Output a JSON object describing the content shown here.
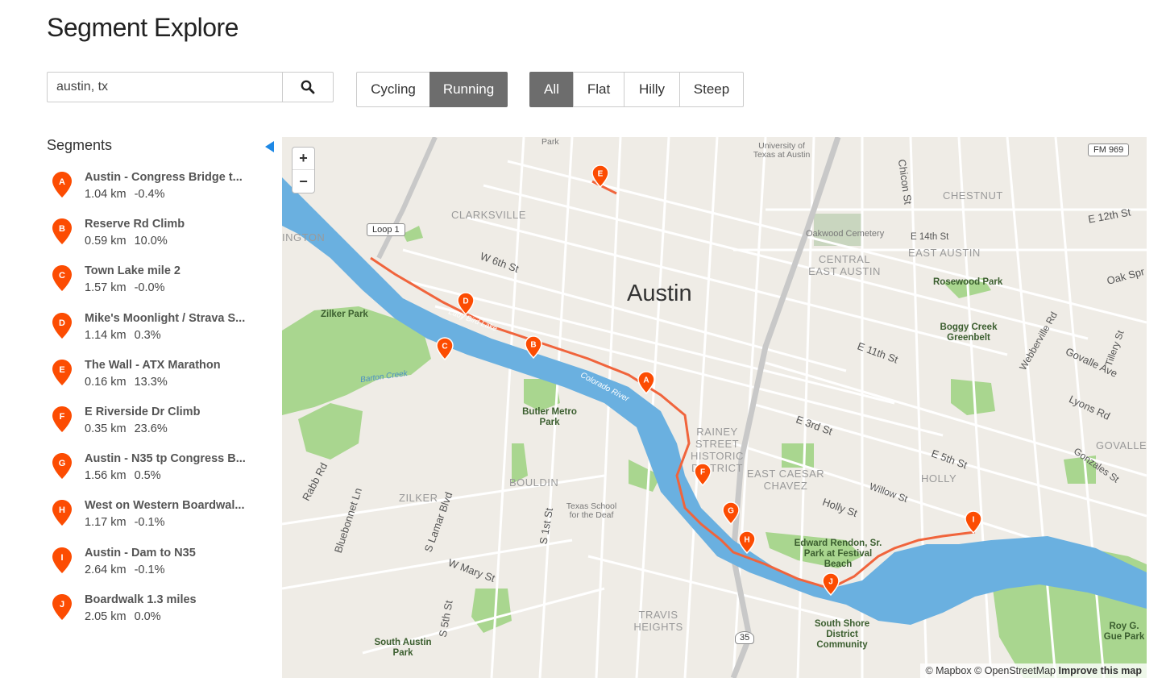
{
  "page": {
    "title": "Segment Explore"
  },
  "search": {
    "value": "austin, tx",
    "icon": "search-icon"
  },
  "sport_filter": [
    {
      "label": "Cycling",
      "active": false
    },
    {
      "label": "Running",
      "active": true
    }
  ],
  "terrain_filter": [
    {
      "label": "All",
      "active": true
    },
    {
      "label": "Flat",
      "active": false
    },
    {
      "label": "Hilly",
      "active": false
    },
    {
      "label": "Steep",
      "active": false
    }
  ],
  "sidebar": {
    "heading": "Segments",
    "segments": [
      {
        "letter": "A",
        "name": "Austin - Congress Bridge t...",
        "distance": "1.04 km",
        "grade": "-0.4%"
      },
      {
        "letter": "B",
        "name": "Reserve Rd Climb",
        "distance": "0.59 km",
        "grade": "10.0%"
      },
      {
        "letter": "C",
        "name": "Town Lake mile 2",
        "distance": "1.57 km",
        "grade": "-0.0%"
      },
      {
        "letter": "D",
        "name": "Mike's Moonlight / Strava S...",
        "distance": "1.14 km",
        "grade": "0.3%"
      },
      {
        "letter": "E",
        "name": "The Wall - ATX Marathon",
        "distance": "0.16 km",
        "grade": "13.3%"
      },
      {
        "letter": "F",
        "name": "E Riverside Dr Climb",
        "distance": "0.35 km",
        "grade": "23.6%"
      },
      {
        "letter": "G",
        "name": "Austin - N35 tp Congress B...",
        "distance": "1.56 km",
        "grade": "0.5%"
      },
      {
        "letter": "H",
        "name": "West on Western Boardwal...",
        "distance": "1.17 km",
        "grade": "-0.1%"
      },
      {
        "letter": "I",
        "name": "Austin - Dam to N35",
        "distance": "2.64 km",
        "grade": "-0.1%"
      },
      {
        "letter": "J",
        "name": "Boardwalk 1.3 miles",
        "distance": "2.05 km",
        "grade": "0.0%"
      }
    ]
  },
  "map": {
    "zoom_in": "+",
    "zoom_out": "−",
    "city_label": "Austin",
    "districts": [
      "CLARKSVILLE",
      "CENTRAL EAST AUSTIN",
      "CHESTNUT",
      "EAST AUSTIN",
      "RAINEY STREET HISTORIC DISTRICT",
      "EAST CAESAR CHAVEZ",
      "HOLLY",
      "GOVALLE",
      "BOULDIN",
      "ZILKER",
      "TRAVIS HEIGHTS",
      "INGTON"
    ],
    "parks": [
      "Zilker Park",
      "Butler Metro Park",
      "Rosewood Park",
      "Boggy Creek Greenbelt",
      "Edward Rendon, Sr. Park at Festival Beach",
      "South Shore District Community",
      "South Austin Park",
      "Roy G. Gue Park",
      "Oakwood Cemetery",
      "University of Texas at Austin",
      "Texas School for the Deaf",
      "Park"
    ],
    "streets": [
      "W 6th St",
      "E 11th St",
      "E 12th St",
      "E 14th St",
      "Chicon St",
      "E 3rd St",
      "E 5th St",
      "Holly St",
      "Willow St",
      "Webberville Rd",
      "Tillery St",
      "Govalle Ave",
      "Lyons Rd",
      "Gonzales St",
      "Oak Spr",
      "Rabb Rd",
      "Bluebonnet Ln",
      "S Lamar Blvd",
      "S 1st St",
      "S 5th St",
      "W Mary St",
      "Lady Bird Lake",
      "Barton Creek",
      "Colorado River"
    ],
    "shields": [
      "Loop 1",
      "FM 969",
      "35"
    ],
    "attribution": {
      "mapbox": "© Mapbox",
      "osm": "© OpenStreetMap",
      "improve": "Improve this map"
    },
    "colors": {
      "route": "#f0643c",
      "water": "#6ab0e0",
      "park": "#9fd38a",
      "road": "#ffffff",
      "land": "#efece6"
    }
  }
}
